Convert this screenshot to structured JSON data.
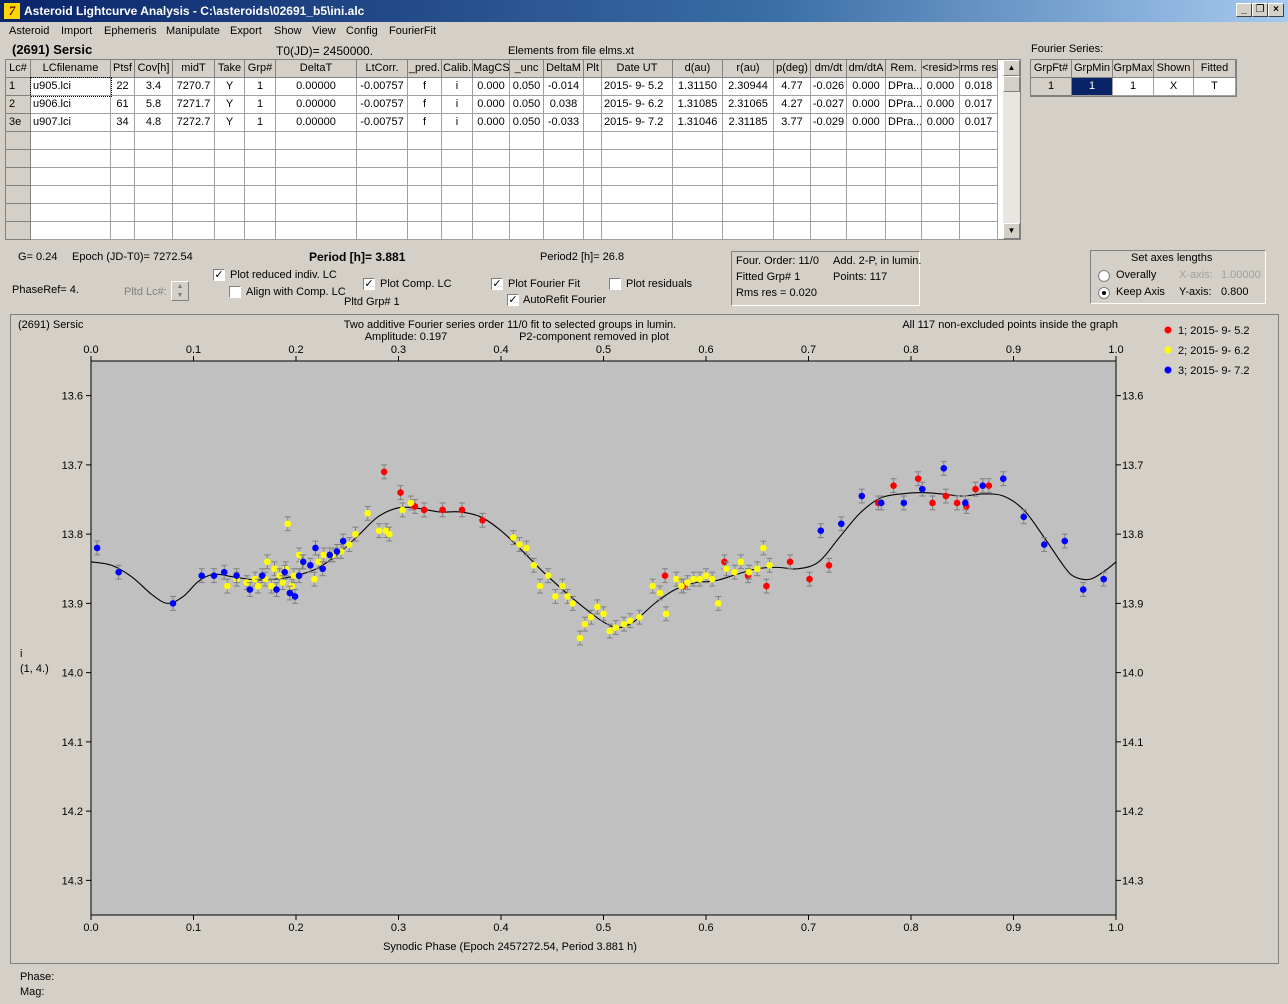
{
  "window": {
    "title": "Asteroid Lightcurve Analysis - C:\\asteroids\\02691_b5\\ini.alc",
    "app_icon": "7"
  },
  "menu": [
    "Asteroid",
    "Import",
    "Ephemeris",
    "Manipulate",
    "Export",
    "Show",
    "View",
    "Config",
    "FourierFit"
  ],
  "header": {
    "asteroid": "(2691) Sersic",
    "t0": "T0(JD)= 2450000.",
    "elements": "Elements from file elms.xt"
  },
  "lc_table": {
    "columns": [
      "Lc#",
      "LCfilename",
      "Ptsf",
      "Cov[h]",
      "midT",
      "Take",
      "Grp#",
      "DeltaT",
      "LtCorr.",
      "_pred.",
      "Calib.",
      "MagCS",
      "_unc",
      "DeltaM",
      "Plt",
      "Date UT",
      "d(au)",
      "r(au)",
      "p(deg)",
      "dm/dt",
      "dm/dtA",
      "Rem.",
      "<resid>",
      "rms res"
    ],
    "rows": [
      [
        "1",
        "u905.lci",
        "22",
        "3.4",
        "7270.7",
        "Y",
        "1",
        "0.00000",
        "-0.00757",
        "f",
        "i",
        "0.000",
        "0.050",
        "-0.014",
        "",
        "2015- 9- 5.2",
        "1.31150",
        "2.30944",
        "4.77",
        "-0.026",
        "0.000",
        "DPra...",
        "0.000",
        "0.018"
      ],
      [
        "2",
        "u906.lci",
        "61",
        "5.8",
        "7271.7",
        "Y",
        "1",
        "0.00000",
        "-0.00757",
        "f",
        "i",
        "0.000",
        "0.050",
        "0.038",
        "",
        "2015- 9- 6.2",
        "1.31085",
        "2.31065",
        "4.27",
        "-0.027",
        "0.000",
        "DPra...",
        "0.000",
        "0.017"
      ],
      [
        "3e",
        "u907.lci",
        "34",
        "4.8",
        "7272.7",
        "Y",
        "1",
        "0.00000",
        "-0.00757",
        "f",
        "i",
        "0.000",
        "0.050",
        "-0.033",
        "",
        "2015- 9- 7.2",
        "1.31046",
        "2.31185",
        "3.77",
        "-0.029",
        "0.000",
        "DPra...",
        "0.000",
        "0.017"
      ]
    ]
  },
  "fourier_series": {
    "label": "Fourier Series:",
    "columns": [
      "GrpFt#",
      "GrpMin",
      "GrpMax",
      "Shown",
      "Fitted"
    ],
    "row": [
      "1",
      "1",
      "1",
      "X",
      "T"
    ]
  },
  "info": {
    "g": "G= 0.24",
    "epoch": "Epoch (JD-T0)= 7272.54",
    "period": "Period [h]= 3.881",
    "period2": "Period2 [h]= 26.8",
    "phaseref": "PhaseRef= 4.",
    "pltd_lc": "Pltd Lc#:",
    "pltd_grp": "Pltd Grp#  1"
  },
  "checkboxes": {
    "plot_reduced": {
      "label": "Plot reduced indiv. LC",
      "checked": true
    },
    "align_comp": {
      "label": "Align with Comp. LC",
      "checked": false
    },
    "plot_comp": {
      "label": "Plot Comp. LC",
      "checked": true
    },
    "plot_fourier": {
      "label": "Plot Fourier Fit",
      "checked": true
    },
    "plot_residuals": {
      "label": "Plot residuals",
      "checked": false
    },
    "autorefit": {
      "label": "AutoRefit Fourier",
      "checked": true
    }
  },
  "fit_box": {
    "order": "Four. Order: 11/0",
    "add": "Add. 2-P, in lumin.",
    "grp": "Fitted Grp# 1",
    "points": "Points: 117",
    "rms": "Rms res     = 0.020"
  },
  "axes_box": {
    "title": "Set axes lengths",
    "overally": "Overally",
    "keep_axis": "Keep Axis",
    "x_axis_label": "X-axis:",
    "x_axis_value": "1.00000",
    "y_axis_label": "Y-axis:",
    "y_axis_value": "0.800",
    "selected": "Keep Axis"
  },
  "status": {
    "phase": "Phase:",
    "mag": "Mag:"
  },
  "colors": {
    "series1": "#ff0000",
    "series2": "#ffff00",
    "series3": "#0000ff",
    "plot_bg": "#c0c0c0"
  },
  "chart_data": {
    "type": "scatter",
    "object_label": "(2691) Sersic",
    "title": "Two additive Fourier series order 11/0 fit to selected groups in lumin.",
    "amplitude": "Amplitude: 0.197",
    "p2_note": "P2-component removed in plot",
    "inside_note": "All 117 non-excluded points inside the graph",
    "xlabel": "Synodic Phase (Epoch 2457272.54, Period 3.881 h)",
    "ylabel": "i",
    "ylabel2": "(1, 4.)",
    "xlim": [
      0,
      1
    ],
    "ylim": [
      14.35,
      13.55
    ],
    "y_inverted": true,
    "xticks": [
      "0.0",
      "0.1",
      "0.2",
      "0.3",
      "0.4",
      "0.5",
      "0.6",
      "0.7",
      "0.8",
      "0.9",
      "1.0"
    ],
    "yticks": [
      "13.6",
      "13.7",
      "13.8",
      "13.9",
      "14.0",
      "14.1",
      "14.2",
      "14.3"
    ],
    "error": 0.01,
    "series": [
      {
        "name": "1; 2015- 9- 5.2",
        "color": "#ff0000",
        "points": [
          [
            0.286,
            13.71
          ],
          [
            0.302,
            13.74
          ],
          [
            0.316,
            13.76
          ],
          [
            0.325,
            13.765
          ],
          [
            0.343,
            13.765
          ],
          [
            0.362,
            13.765
          ],
          [
            0.382,
            13.78
          ],
          [
            0.56,
            13.86
          ],
          [
            0.578,
            13.875
          ],
          [
            0.618,
            13.84
          ],
          [
            0.641,
            13.86
          ],
          [
            0.659,
            13.875
          ],
          [
            0.682,
            13.84
          ],
          [
            0.701,
            13.865
          ],
          [
            0.72,
            13.845
          ],
          [
            0.768,
            13.755
          ],
          [
            0.783,
            13.73
          ],
          [
            0.807,
            13.72
          ],
          [
            0.821,
            13.755
          ],
          [
            0.834,
            13.745
          ],
          [
            0.845,
            13.755
          ],
          [
            0.854,
            13.76
          ],
          [
            0.863,
            13.735
          ],
          [
            0.876,
            13.73
          ]
        ]
      },
      {
        "name": "2; 2015- 9- 6.2",
        "color": "#ffff00",
        "points": [
          [
            0.133,
            13.875
          ],
          [
            0.142,
            13.865
          ],
          [
            0.152,
            13.87
          ],
          [
            0.16,
            13.865
          ],
          [
            0.163,
            13.875
          ],
          [
            0.17,
            13.865
          ],
          [
            0.172,
            13.84
          ],
          [
            0.176,
            13.875
          ],
          [
            0.179,
            13.85
          ],
          [
            0.184,
            13.86
          ],
          [
            0.187,
            13.87
          ],
          [
            0.19,
            13.85
          ],
          [
            0.192,
            13.785
          ],
          [
            0.196,
            13.875
          ],
          [
            0.198,
            13.86
          ],
          [
            0.203,
            13.83
          ],
          [
            0.206,
            13.84
          ],
          [
            0.218,
            13.865
          ],
          [
            0.222,
            13.84
          ],
          [
            0.227,
            13.83
          ],
          [
            0.236,
            13.83
          ],
          [
            0.244,
            13.825
          ],
          [
            0.252,
            13.815
          ],
          [
            0.258,
            13.8
          ],
          [
            0.27,
            13.77
          ],
          [
            0.281,
            13.795
          ],
          [
            0.288,
            13.795
          ],
          [
            0.291,
            13.8
          ],
          [
            0.304,
            13.765
          ],
          [
            0.312,
            13.755
          ],
          [
            0.412,
            13.805
          ],
          [
            0.418,
            13.815
          ],
          [
            0.425,
            13.82
          ],
          [
            0.432,
            13.845
          ],
          [
            0.438,
            13.875
          ],
          [
            0.446,
            13.86
          ],
          [
            0.453,
            13.89
          ],
          [
            0.46,
            13.875
          ],
          [
            0.465,
            13.89
          ],
          [
            0.47,
            13.9
          ],
          [
            0.477,
            13.95
          ],
          [
            0.482,
            13.93
          ],
          [
            0.488,
            13.92
          ],
          [
            0.494,
            13.905
          ],
          [
            0.5,
            13.915
          ],
          [
            0.506,
            13.94
          ],
          [
            0.512,
            13.935
          ],
          [
            0.52,
            13.93
          ],
          [
            0.526,
            13.925
          ],
          [
            0.535,
            13.92
          ],
          [
            0.548,
            13.875
          ],
          [
            0.555,
            13.885
          ],
          [
            0.561,
            13.915
          ],
          [
            0.571,
            13.865
          ],
          [
            0.576,
            13.875
          ],
          [
            0.582,
            13.87
          ],
          [
            0.588,
            13.865
          ],
          [
            0.594,
            13.865
          ],
          [
            0.6,
            13.86
          ],
          [
            0.606,
            13.865
          ],
          [
            0.612,
            13.9
          ],
          [
            0.62,
            13.85
          ],
          [
            0.628,
            13.855
          ],
          [
            0.634,
            13.84
          ],
          [
            0.642,
            13.855
          ],
          [
            0.65,
            13.85
          ],
          [
            0.656,
            13.82
          ],
          [
            0.662,
            13.845
          ]
        ]
      },
      {
        "name": "3; 2015- 9- 7.2",
        "color": "#0000ff",
        "points": [
          [
            0.006,
            13.82
          ],
          [
            0.027,
            13.855
          ],
          [
            0.08,
            13.9
          ],
          [
            0.108,
            13.86
          ],
          [
            0.12,
            13.86
          ],
          [
            0.13,
            13.855
          ],
          [
            0.142,
            13.86
          ],
          [
            0.155,
            13.88
          ],
          [
            0.167,
            13.86
          ],
          [
            0.181,
            13.88
          ],
          [
            0.189,
            13.855
          ],
          [
            0.194,
            13.885
          ],
          [
            0.199,
            13.89
          ],
          [
            0.203,
            13.86
          ],
          [
            0.207,
            13.84
          ],
          [
            0.214,
            13.845
          ],
          [
            0.219,
            13.82
          ],
          [
            0.226,
            13.85
          ],
          [
            0.233,
            13.83
          ],
          [
            0.24,
            13.825
          ],
          [
            0.246,
            13.81
          ],
          [
            0.712,
            13.795
          ],
          [
            0.732,
            13.785
          ],
          [
            0.752,
            13.745
          ],
          [
            0.771,
            13.755
          ],
          [
            0.793,
            13.755
          ],
          [
            0.811,
            13.735
          ],
          [
            0.832,
            13.705
          ],
          [
            0.853,
            13.755
          ],
          [
            0.87,
            13.73
          ],
          [
            0.89,
            13.72
          ],
          [
            0.91,
            13.775
          ],
          [
            0.93,
            13.815
          ],
          [
            0.95,
            13.81
          ],
          [
            0.968,
            13.88
          ],
          [
            0.988,
            13.865
          ]
        ]
      }
    ],
    "fit_curve": [
      [
        0.0,
        13.84
      ],
      [
        0.02,
        13.845
      ],
      [
        0.04,
        13.862
      ],
      [
        0.06,
        13.888
      ],
      [
        0.075,
        13.9
      ],
      [
        0.09,
        13.89
      ],
      [
        0.105,
        13.868
      ],
      [
        0.12,
        13.858
      ],
      [
        0.14,
        13.862
      ],
      [
        0.16,
        13.866
      ],
      [
        0.18,
        13.865
      ],
      [
        0.2,
        13.86
      ],
      [
        0.22,
        13.85
      ],
      [
        0.24,
        13.83
      ],
      [
        0.26,
        13.803
      ],
      [
        0.28,
        13.775
      ],
      [
        0.3,
        13.762
      ],
      [
        0.32,
        13.763
      ],
      [
        0.34,
        13.768
      ],
      [
        0.36,
        13.768
      ],
      [
        0.38,
        13.775
      ],
      [
        0.4,
        13.795
      ],
      [
        0.42,
        13.823
      ],
      [
        0.44,
        13.853
      ],
      [
        0.46,
        13.88
      ],
      [
        0.48,
        13.905
      ],
      [
        0.5,
        13.927
      ],
      [
        0.515,
        13.935
      ],
      [
        0.53,
        13.926
      ],
      [
        0.55,
        13.9
      ],
      [
        0.57,
        13.88
      ],
      [
        0.59,
        13.87
      ],
      [
        0.61,
        13.867
      ],
      [
        0.63,
        13.858
      ],
      [
        0.65,
        13.85
      ],
      [
        0.67,
        13.848
      ],
      [
        0.69,
        13.85
      ],
      [
        0.71,
        13.84
      ],
      [
        0.73,
        13.805
      ],
      [
        0.75,
        13.77
      ],
      [
        0.77,
        13.748
      ],
      [
        0.79,
        13.742
      ],
      [
        0.81,
        13.74
      ],
      [
        0.83,
        13.742
      ],
      [
        0.85,
        13.745
      ],
      [
        0.87,
        13.742
      ],
      [
        0.89,
        13.745
      ],
      [
        0.91,
        13.765
      ],
      [
        0.93,
        13.805
      ],
      [
        0.95,
        13.848
      ],
      [
        0.96,
        13.862
      ],
      [
        0.975,
        13.865
      ],
      [
        0.99,
        13.852
      ],
      [
        1.0,
        13.84
      ]
    ]
  }
}
